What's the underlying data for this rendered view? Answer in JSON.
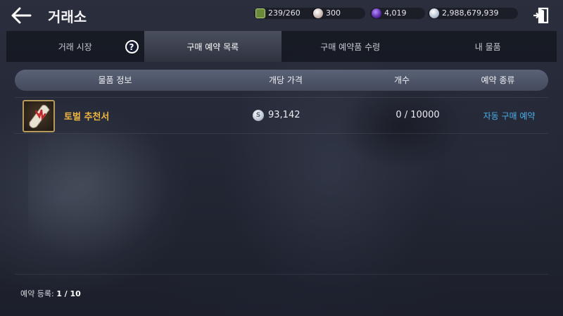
{
  "header": {
    "title": "거래소"
  },
  "currencies": [
    {
      "icon": "energy-icon",
      "value": "239/260"
    },
    {
      "icon": "pearl-icon",
      "value": "300"
    },
    {
      "icon": "purple-orb-icon",
      "value": "4,019"
    },
    {
      "icon": "silver-coin-icon",
      "value": "2,988,679,939"
    }
  ],
  "tabs": [
    {
      "label": "거래 시장",
      "active": false
    },
    {
      "label": "구매 예약 목록",
      "active": true
    },
    {
      "label": "구매 예약품 수령",
      "active": false
    },
    {
      "label": "내 물품",
      "active": false
    }
  ],
  "table": {
    "columns": [
      "물품 정보",
      "개당 가격",
      "개수",
      "예약 종류"
    ],
    "rows": [
      {
        "item_icon": "scroll-icon",
        "name": "토벌 추천서",
        "price": "93,142",
        "count": "0 / 10000",
        "type": "자동 구매 예약"
      }
    ]
  },
  "footer": {
    "label": "예약 등록:",
    "value": "1 / 10"
  },
  "colors": {
    "item_name": "#f0b640",
    "reservation_type": "#4ab0e8",
    "active_tab": "#4a4f5e"
  }
}
